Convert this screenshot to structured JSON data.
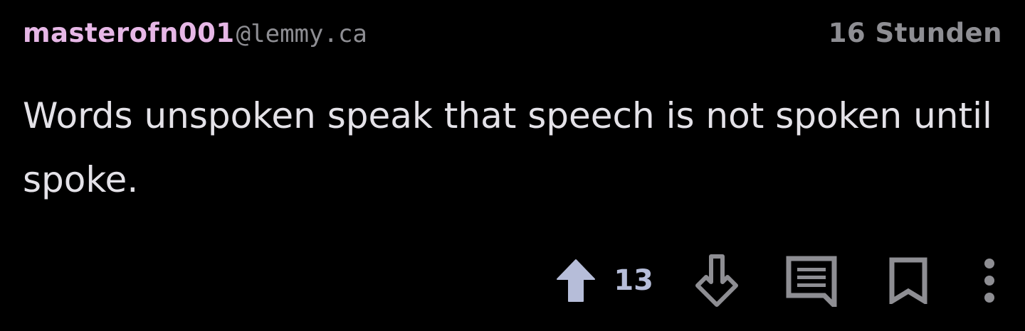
{
  "comment": {
    "author": {
      "username": "masterofn001",
      "instance": "@lemmy.ca"
    },
    "timestamp": "16 Stunden",
    "body": "Words unspoken speak that speech is not spoken until spoke.",
    "actions": {
      "upvote_icon": "arrow-up-icon",
      "score": "13",
      "downvote_icon": "arrow-down-icon",
      "reply_icon": "comment-icon",
      "save_icon": "bookmark-icon",
      "more_icon": "more-vertical-icon"
    }
  },
  "colors": {
    "background": "#000000",
    "username": "#e6b7e6",
    "muted": "#8e8e93",
    "body_text": "#e4e2e8",
    "upvoted": "#b6bdd9"
  }
}
